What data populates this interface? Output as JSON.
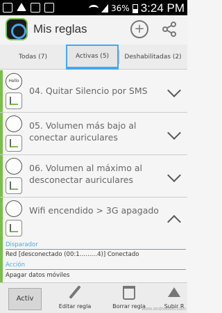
{
  "status_bar": {
    "battery": "36%",
    "time": "3:24 PM"
  },
  "app": {
    "title": "Mis reglas",
    "accent": "#3fa9f5",
    "green": "#7ac143"
  },
  "tabs": [
    {
      "label": "Todas (7)"
    },
    {
      "label": "Activas (5)",
      "selected": true
    },
    {
      "label": "Deshabilitadas (2)"
    }
  ],
  "rules": [
    {
      "title": "04. Quitar Silencio por SMS",
      "icon1": "sms-hello-icon",
      "icon2": "sound-icon"
    },
    {
      "title": "05. Volumen más bajo al conectar auriculares",
      "icon1": "headphones-icon",
      "icon2": "volume-slider-icon"
    },
    {
      "title": "06. Volumen al máximo al desconectar auriculares",
      "icon1": "headphones-icon",
      "icon2": "volume-slider-icon"
    },
    {
      "title": "Wifi encendido > 3G apagado",
      "icon1": "wifi-icon",
      "icon2": "data-arrows-icon",
      "expanded": true
    }
  ],
  "details": {
    "trigger_label": "Disparador",
    "trigger_value": "Red [desconectado (00:1………4)] Conectado",
    "action_label": "Acción",
    "action_value": "Apagar datos móviles"
  },
  "bottom_bar": {
    "activ": "Activ",
    "edit": "Editar regla",
    "delete": "Borrar regla",
    "up": "Subir R"
  },
  "watermark": "www.androidsis.com"
}
